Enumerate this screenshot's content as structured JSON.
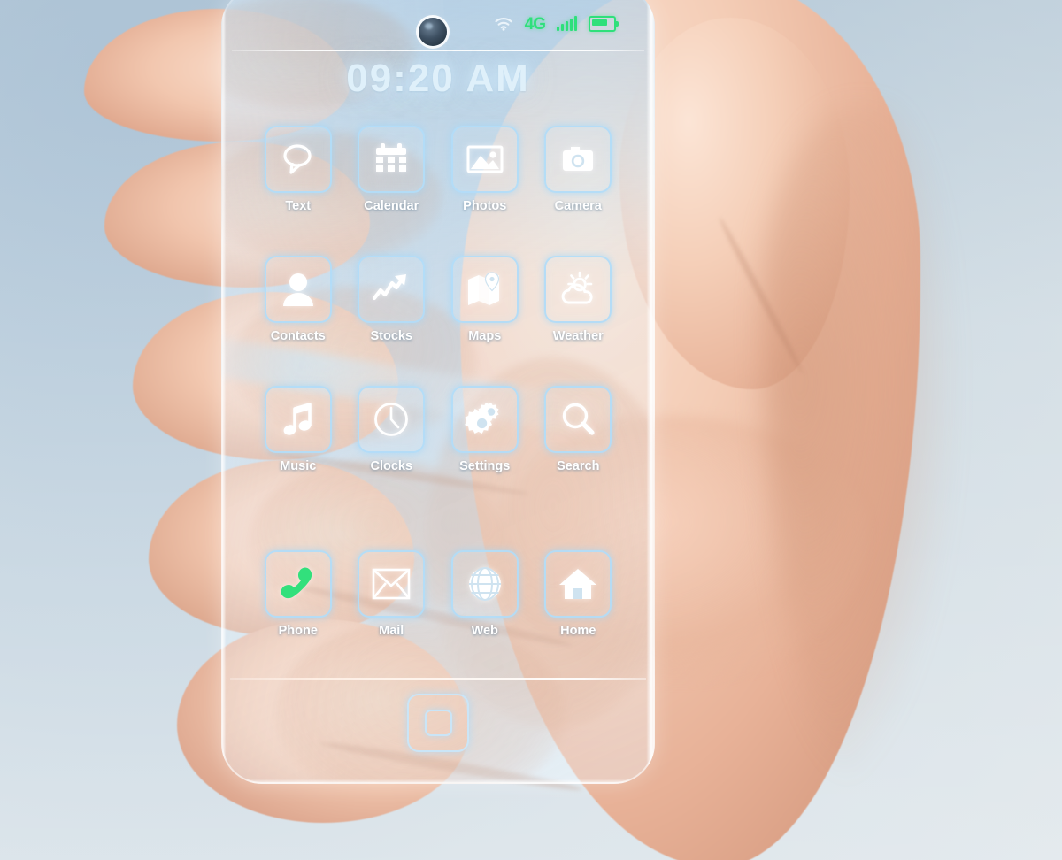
{
  "device": {
    "name": "transparent-smartphone",
    "status_bar": {
      "wifi_icon": "wifi-icon",
      "network_label": "4G",
      "signal_icon": "signal-bars-icon",
      "battery_icon": "battery-icon",
      "accent_color": "#2fe07b"
    },
    "clock": "09:20 AM",
    "camera_icon": "front-camera-icon",
    "home_button_icon": "home-button-icon"
  },
  "home_screen": {
    "apps": [
      {
        "label": "Text",
        "icon": "speech-bubble-icon"
      },
      {
        "label": "Calendar",
        "icon": "calendar-icon"
      },
      {
        "label": "Photos",
        "icon": "photo-image-icon"
      },
      {
        "label": "Camera",
        "icon": "camera-icon"
      },
      {
        "label": "Contacts",
        "icon": "person-icon"
      },
      {
        "label": "Stocks",
        "icon": "trending-up-arrow-icon"
      },
      {
        "label": "Maps",
        "icon": "map-pin-icon"
      },
      {
        "label": "Weather",
        "icon": "sun-cloud-icon"
      },
      {
        "label": "Music",
        "icon": "music-note-icon"
      },
      {
        "label": "Clocks",
        "icon": "clock-face-icon"
      },
      {
        "label": "Settings",
        "icon": "gears-icon"
      },
      {
        "label": "Search",
        "icon": "magnifying-glass-icon"
      }
    ],
    "dock": [
      {
        "label": "Phone",
        "icon": "phone-handset-icon",
        "color": "#32e07c"
      },
      {
        "label": "Mail",
        "icon": "envelope-icon",
        "color": "#ffffff"
      },
      {
        "label": "Web",
        "icon": "globe-icon",
        "color": "#ffffff"
      },
      {
        "label": "Home",
        "icon": "house-icon",
        "color": "#ffffff"
      }
    ]
  },
  "theme": {
    "tile_border_color": "#b2dcf8",
    "label_color": "#ffffff",
    "clock_color": "#dff0fa",
    "background_color": "#c3d3e0"
  }
}
